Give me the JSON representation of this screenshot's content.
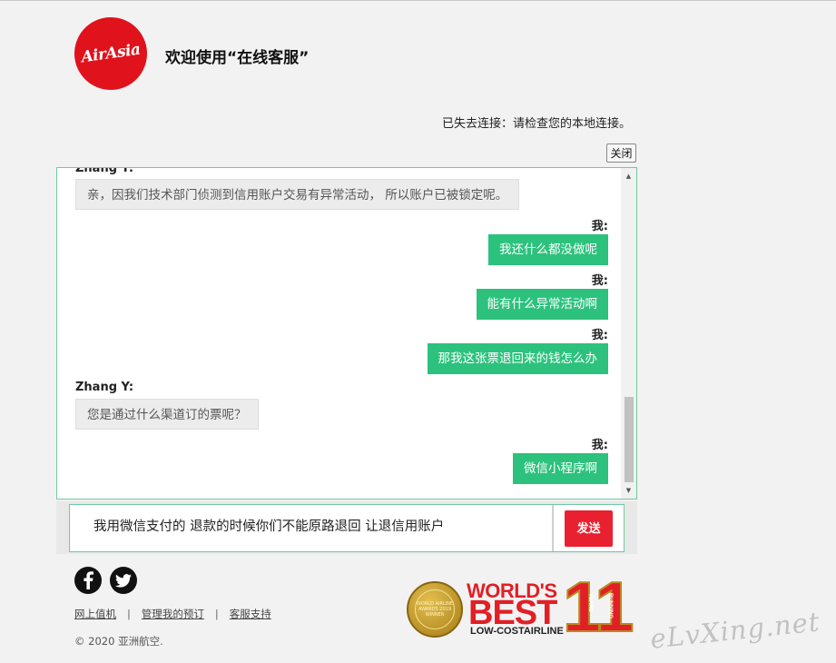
{
  "header": {
    "logo_text": "AirAsia",
    "welcome": "欢迎使用“在线客服”"
  },
  "status_text": "已失去连接：请检查您的本地连接。",
  "close_label": "关闭",
  "chat": {
    "partial_sender": "Zhang Y:",
    "messages": [
      {
        "sender": "",
        "text": "亲，因我们技术部门侦测到信用账户交易有异常活动， 所以账户已被锁定呢。"
      },
      {
        "sender": "我:",
        "text": "我还什么都没做呢"
      },
      {
        "sender": "我:",
        "text": "能有什么异常活动啊"
      },
      {
        "sender": "我:",
        "text": "那我这张票退回来的钱怎么办"
      },
      {
        "sender": "Zhang Y:",
        "text": "您是通过什么渠道订的票呢？"
      },
      {
        "sender": "我:",
        "text": "微信小程序啊"
      }
    ]
  },
  "input": {
    "value": "我用微信支付的 退款的时候你们不能原路退回  让退信用账户",
    "send_label": "发送"
  },
  "footer": {
    "links": [
      "网上值机",
      "管理我的预订",
      "客服支持"
    ],
    "separator": "|",
    "copyright": "© 2020 亚洲航空."
  },
  "award": {
    "medal_text": "WORLD AIRLINE AWARDS 2019 WINNER",
    "line1": "WORLD'S",
    "line2": "BEST",
    "line3": "LOW-COSTAIRLINE",
    "number": "11",
    "years": "YEARS",
    "running": "RUNNING"
  },
  "watermark": "eLvXing.net",
  "colors": {
    "brand_red": "#e0121b",
    "my_bubble": "#2cc27d",
    "agent_bubble": "#ececec",
    "chat_border": "#6fc9a2",
    "send_button": "#e9202f"
  },
  "icons": [
    "facebook-icon",
    "twitter-icon",
    "scroll-up-icon",
    "scroll-down-icon"
  ]
}
